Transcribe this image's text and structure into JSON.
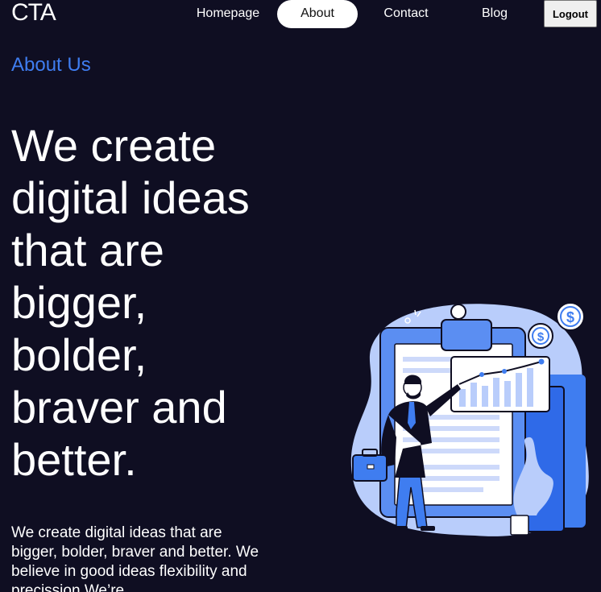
{
  "header": {
    "logo": "CTA",
    "nav": [
      {
        "label": "Homepage",
        "active": false
      },
      {
        "label": "About",
        "active": true
      },
      {
        "label": "Contact",
        "active": false
      },
      {
        "label": "Blog",
        "active": false
      }
    ],
    "logout_label": "Logout"
  },
  "main": {
    "section_label": "About Us",
    "headline": "We create digital ideas that are bigger, bolder, braver and better.",
    "body": "We create digital ideas that are bigger, bolder, braver and better. We believe in good ideas flexibility and precission We’re"
  },
  "illustration": {
    "coin_symbol": "$",
    "colors": {
      "background": "#0f0e22",
      "accent": "#3f7df0",
      "light_blue": "#b9cdfb",
      "mid_blue": "#5b8ef2"
    }
  }
}
